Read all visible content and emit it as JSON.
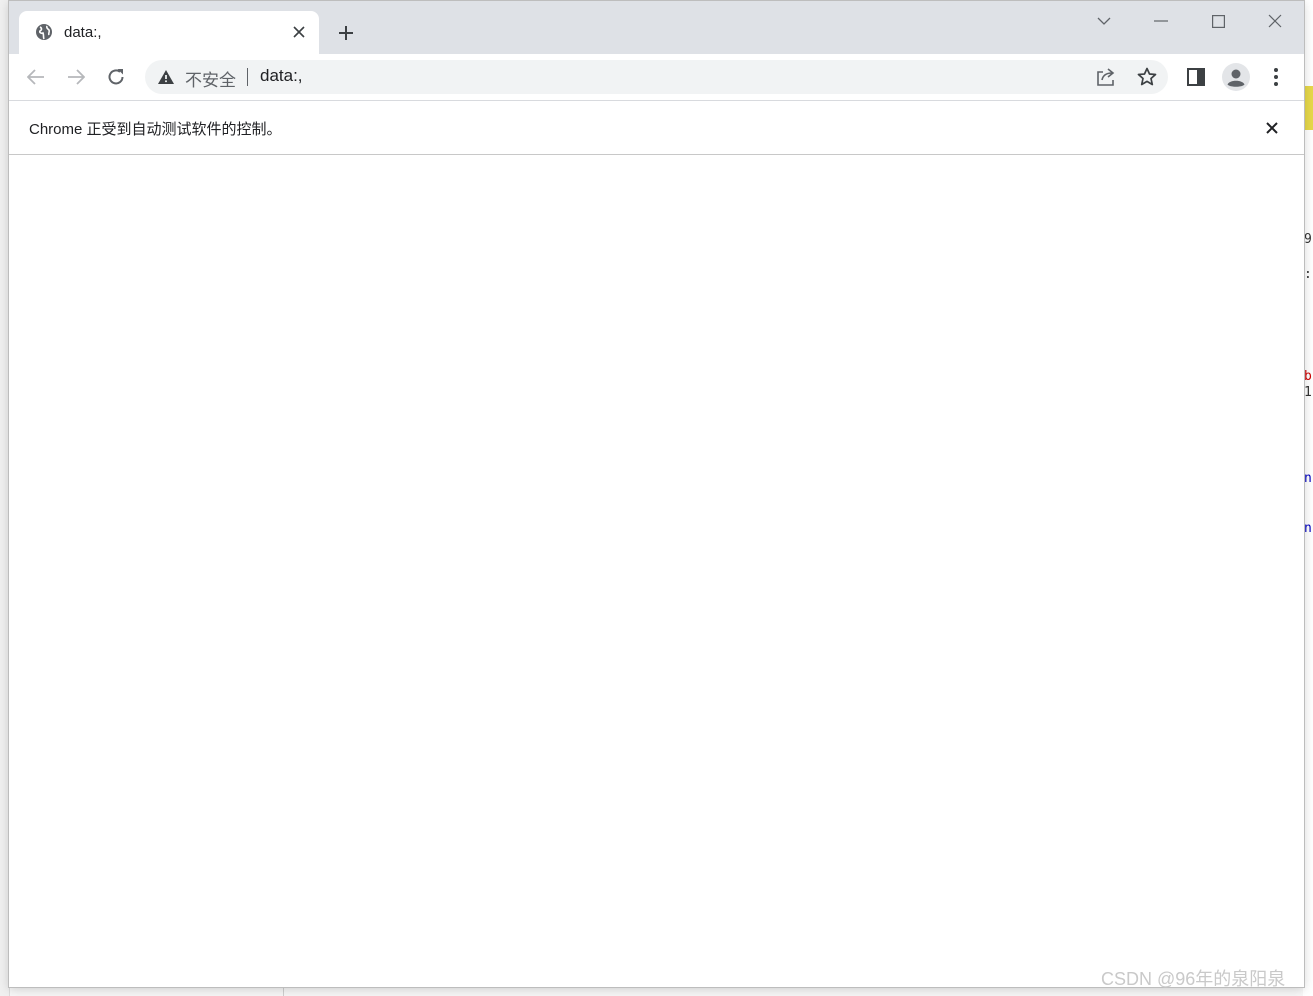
{
  "tab": {
    "title": "data:,"
  },
  "address_bar": {
    "security_label": "不安全",
    "url": "data:,"
  },
  "infobar": {
    "message": "Chrome 正受到自动测试软件的控制。"
  },
  "watermark": {
    "text": "CSDN @96年的泉阳泉"
  },
  "background_code": {
    "line1": "9",
    "line2": ":",
    "line3": "b",
    "line4": "1",
    "line5": "n",
    "line6": "n"
  },
  "colors": {
    "tabstrip": "#dee1e6",
    "omnibox": "#f1f3f4",
    "icon": "#5f6368"
  },
  "icons": {
    "favicon": "globe-icon",
    "tab_close": "close-icon",
    "new_tab": "plus-icon",
    "tab_search": "chevron-down-icon",
    "minimize": "minimize-icon",
    "maximize": "maximize-icon",
    "close": "close-icon",
    "back": "arrow-left-icon",
    "forward": "arrow-right-icon",
    "reload": "reload-icon",
    "security": "warning-icon",
    "share": "share-icon",
    "bookmark": "star-icon",
    "side_panel": "side-panel-icon",
    "profile": "profile-icon",
    "menu": "kebab-menu-icon"
  }
}
